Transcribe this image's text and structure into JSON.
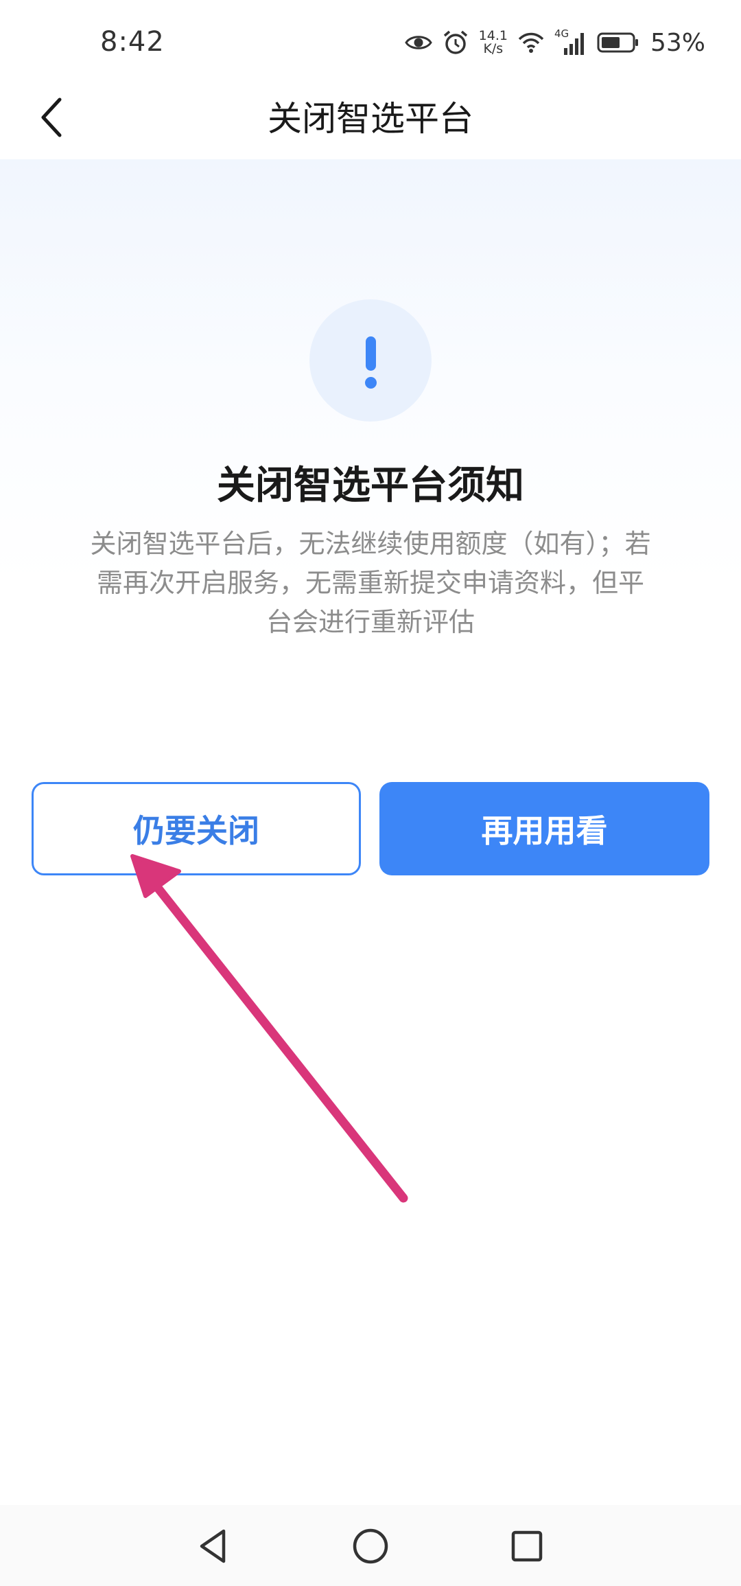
{
  "status_bar": {
    "time": "8:42",
    "net_speed_value": "14.1",
    "net_speed_unit": "K/s",
    "network_type": "4G",
    "battery_percent": "53%",
    "icons": [
      "eye-icon",
      "alarm-icon",
      "wifi-icon",
      "signal-icon",
      "battery-icon"
    ]
  },
  "header": {
    "title": "关闭智选平台",
    "back_icon": "chevron-left-icon"
  },
  "notice": {
    "icon": "exclamation-icon",
    "title": "关闭智选平台须知",
    "description": "关闭智选平台后，无法继续使用额度（如有）；若需再次开启服务，无需重新提交申请资料，但平台会进行重新评估"
  },
  "actions": {
    "confirm_close_label": "仍要关闭",
    "keep_using_label": "再用用看"
  },
  "colors": {
    "accent": "#3d86f7",
    "annotation_arrow": "#d9367a",
    "muted_text": "#8c8c8c"
  },
  "system_nav": {
    "icons": [
      "back-triangle-icon",
      "home-circle-icon",
      "recents-square-icon"
    ]
  }
}
